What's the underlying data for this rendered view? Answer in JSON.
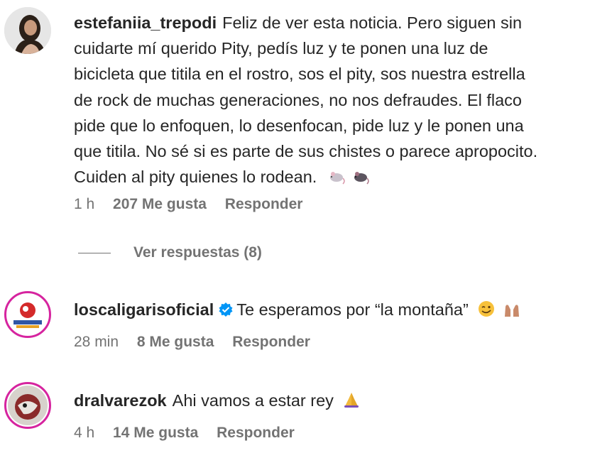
{
  "comments": [
    {
      "username": "estefaniia_trepodi",
      "text_lines": [
        "Feliz de ver esta noticia. Pero siguen sin",
        "cuidarte mí querido Pity, pedís luz y te ponen una luz de",
        "bicicleta que titila en el rostro, sos el pity, sos nuestra estrella",
        "de rock de muchas generaciones, no nos defraudes. El flaco",
        "pide que lo enfoquen, lo desenfocan, pide luz y le ponen una",
        "que titila. No sé si es parte de sus chistes o parece apropocito.",
        "Cuiden al pity quienes lo rodean."
      ],
      "emojis": [
        "rat-emoji",
        "rat-emoji"
      ],
      "time": "1 h",
      "likes": "207 Me gusta",
      "reply": "Responder",
      "view_replies": "Ver respuestas (8)"
    },
    {
      "username": "loscaligarisoficial",
      "verified": true,
      "text": "Te esperamos por “la montaña”",
      "emojis": [
        "winking-face-emoji",
        "raising-hands-emoji"
      ],
      "time": "28 min",
      "likes": "8 Me gusta",
      "reply": "Responder"
    },
    {
      "username": "dralvarezok",
      "text": "Ahi vamos a estar rey",
      "emojis": [
        "folded-hands-emoji"
      ],
      "time": "4 h",
      "likes": "14 Me gusta",
      "reply": "Responder"
    }
  ],
  "colors": {
    "text": "#262626",
    "secondary": "#737373",
    "verified": "#0095f6",
    "story_ring": "#d6249f"
  }
}
